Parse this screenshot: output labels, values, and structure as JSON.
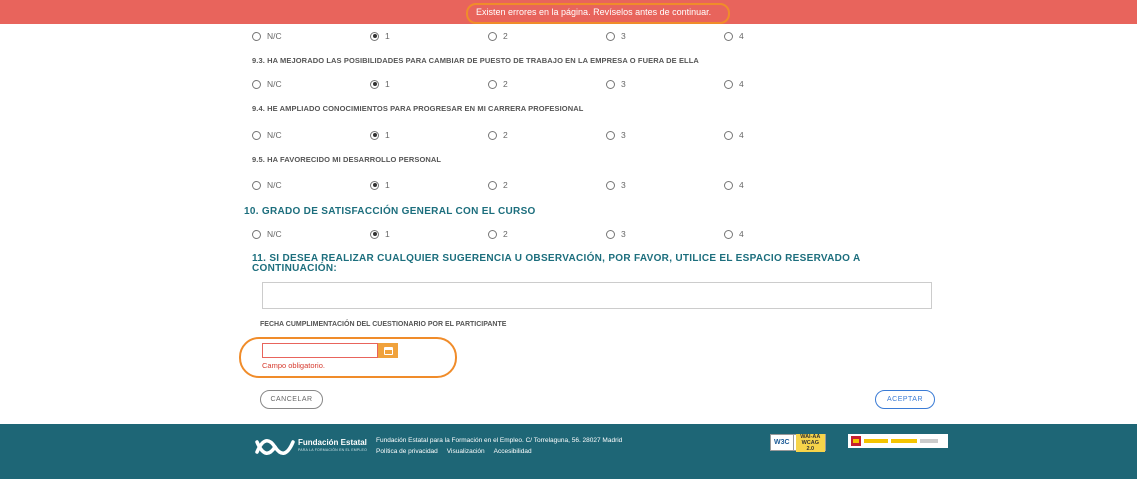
{
  "banner": {
    "error_message": "Existen errores en la página. Revíselos antes de continuar."
  },
  "scale_options": [
    "N/C",
    "1",
    "2",
    "3",
    "4"
  ],
  "questions": {
    "q9_3": "9.3. HA MEJORADO LAS POSIBILIDADES PARA CAMBIAR DE PUESTO DE TRABAJO EN LA EMPRESA O FUERA DE ELLA",
    "q9_4": "9.4. HE AMPLIADO CONOCIMIENTOS PARA PROGRESAR EN MI CARRERA PROFESIONAL",
    "q9_5": "9.5. HA FAVORECIDO MI DESARROLLO PERSONAL",
    "q10": "10. GRADO DE SATISFACCIÓN GENERAL CON EL CURSO",
    "q11": "11. SI DESEA REALIZAR CUALQUIER SUGERENCIA U OBSERVACIÓN, POR FAVOR, UTILICE EL ESPACIO RESERVADO A CONTINUACIÓN:"
  },
  "selected_value": "1",
  "observations": {
    "value": ""
  },
  "date_field": {
    "label": "FECHA CUMPLIMENTACIÓN DEL CUESTIONARIO POR EL PARTICIPANTE",
    "value": "",
    "error": "Campo obligatorio."
  },
  "actions": {
    "cancel": "CANCELAR",
    "accept": "ACEPTAR"
  },
  "footer": {
    "org_name": "Fundación Estatal",
    "org_tagline": "PARA LA FORMACIÓN EN EL EMPLEO",
    "address": "Fundación Estatal para la Formación en el Empleo. C/ Torrelaguna, 56. 28027 Madrid",
    "links": [
      "Política de privacidad",
      "Visualización",
      "Accesibilidad"
    ],
    "w3c_label": "W3C",
    "wcag_label": "WAI-AA WCAG 2.0"
  },
  "colors": {
    "error": "#e8645c",
    "highlight": "#f08c2a",
    "teal": "#1e6676",
    "heading": "#1c6e7d",
    "accent_blue": "#3a7bd5"
  }
}
